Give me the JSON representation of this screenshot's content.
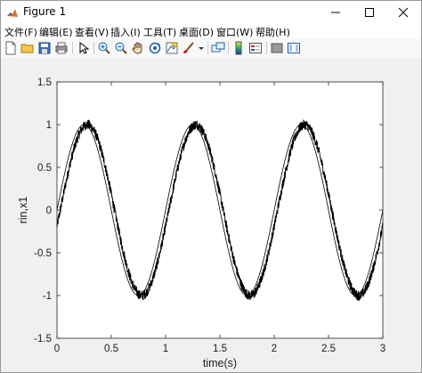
{
  "window": {
    "title": "Figure 1"
  },
  "menu": [
    "文件(F)",
    "编辑(E)",
    "查看(V)",
    "插入(I)",
    "工具(T)",
    "桌面(D)",
    "窗口(W)",
    "帮助(H)"
  ],
  "toolbar": {
    "icons": [
      "new-figure-icon",
      "open-file-icon",
      "save-icon",
      "print-icon",
      "select-arrow-icon",
      "zoom-in-icon",
      "zoom-out-icon",
      "pan-hand-icon",
      "rotate-3d-icon",
      "data-cursor-icon",
      "brush-icon",
      "brush-dropdown-icon",
      "link-plot-icon",
      "colorbar-icon",
      "legend-icon",
      "hide-plot-tools-icon",
      "show-plot-tools-icon"
    ]
  },
  "chart_data": {
    "type": "line",
    "xlabel": "time(s)",
    "ylabel": "rin,x1",
    "xlim": [
      0,
      3
    ],
    "ylim": [
      -1.5,
      1.5
    ],
    "xticks": [
      "0",
      "0.5",
      "1",
      "1.5",
      "2",
      "2.5",
      "3"
    ],
    "yticks": [
      "1.5",
      "1",
      "0.5",
      "0",
      "-0.5",
      "-1",
      "-1.5"
    ],
    "grid": false,
    "series": [
      {
        "kind": "clean sine, amplitude 1, frequency 1 Hz",
        "amplitude": 1.0,
        "frequency_hz": 1.0,
        "phase_lag_s": 0.0,
        "noise": 0.0,
        "color": "#000000"
      },
      {
        "kind": "noisy, lagged sine",
        "amplitude": 1.0,
        "frequency_hz": 1.0,
        "phase_lag_s": 0.03,
        "noise": 0.06,
        "color": "#000000"
      }
    ]
  },
  "colors": {
    "background": "#f0f0f0",
    "axes": "#ffffff",
    "line": "#000000"
  }
}
